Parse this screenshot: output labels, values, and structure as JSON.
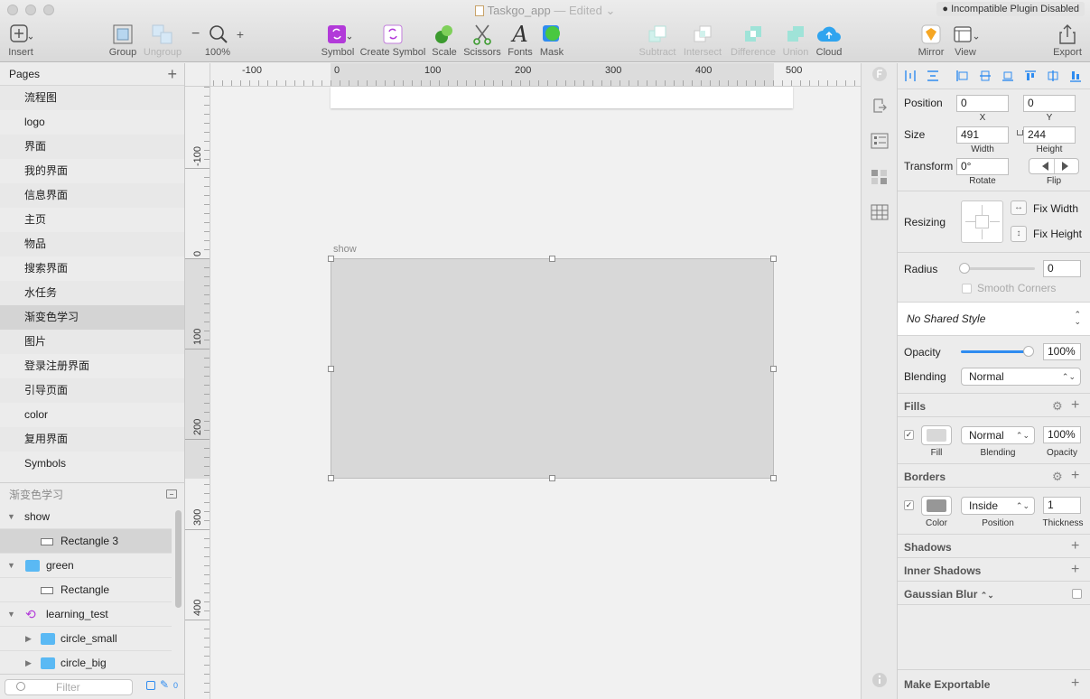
{
  "window": {
    "title": "Taskgo_app",
    "title_suffix": "— Edited",
    "plugin_badge": "Incompatible Plugin Disabled"
  },
  "toolbar": {
    "insert": "Insert",
    "group": "Group",
    "ungroup": "Ungroup",
    "zoom_minus": "−",
    "zoom_plus": "+",
    "zoom": "100%",
    "symbol": "Symbol",
    "create_symbol": "Create Symbol",
    "scale": "Scale",
    "scissors": "Scissors",
    "fonts": "Fonts",
    "mask": "Mask",
    "subtract": "Subtract",
    "intersect": "Intersect",
    "difference": "Difference",
    "union": "Union",
    "cloud": "Cloud",
    "mirror": "Mirror",
    "view": "View",
    "export": "Export"
  },
  "pages": {
    "header": "Pages",
    "items": [
      "流程图",
      "logo",
      "界面",
      "我的界面",
      "信息界面",
      "主页",
      "物品",
      "搜索界面",
      "水任务",
      "渐变色学习",
      "图片",
      "登录注册界面",
      "引导页面",
      "color",
      "复用界面",
      "Symbols"
    ],
    "selected": "渐变色学习"
  },
  "layers": {
    "page_title": "渐变色学习",
    "items": [
      {
        "name": "show",
        "kind": "group"
      },
      {
        "name": "Rectangle 3",
        "kind": "rect"
      },
      {
        "name": "green",
        "kind": "folder"
      },
      {
        "name": "Rectangle",
        "kind": "rect"
      },
      {
        "name": "learning_test",
        "kind": "symbol"
      },
      {
        "name": "circle_small",
        "kind": "folder"
      },
      {
        "name": "circle_big",
        "kind": "folder"
      }
    ],
    "filter_placeholder": "Filter",
    "count": "0"
  },
  "canvas": {
    "ruler_x": [
      "-100",
      "0",
      "100",
      "200",
      "300",
      "400",
      "500"
    ],
    "ruler_y": [
      "-100",
      "0",
      "100",
      "200",
      "300",
      "400"
    ],
    "artboard_name": "show"
  },
  "inspector": {
    "position_label": "Position",
    "x": "0",
    "x_label": "X",
    "y": "0",
    "y_label": "Y",
    "size_label": "Size",
    "width": "491",
    "width_label": "Width",
    "height": "244",
    "height_label": "Height",
    "transform_label": "Transform",
    "rotate": "0°",
    "rotate_label": "Rotate",
    "flip_label": "Flip",
    "resizing_label": "Resizing",
    "fix_width": "Fix Width",
    "fix_height": "Fix Height",
    "radius_label": "Radius",
    "radius": "0",
    "smooth_corners": "Smooth Corners",
    "shared_style": "No Shared Style",
    "opacity_label": "Opacity",
    "opacity": "100%",
    "blending_label": "Blending",
    "blending": "Normal",
    "fills_title": "Fills",
    "fill_label": "Fill",
    "fill_blending": "Normal",
    "fill_blending_label": "Blending",
    "fill_opacity": "100%",
    "fill_opacity_label": "Opacity",
    "fill_color": "#d8d8d8",
    "borders_title": "Borders",
    "border_color_label": "Color",
    "border_position": "Inside",
    "border_position_label": "Position",
    "border_thickness": "1",
    "border_thickness_label": "Thickness",
    "border_color": "#979797",
    "shadows_title": "Shadows",
    "inner_shadows_title": "Inner Shadows",
    "gaussian_blur_title": "Gaussian Blur",
    "make_exportable": "Make Exportable"
  },
  "colors": {
    "accent_blue": "#2f8cf0",
    "symbol_purple": "#b23ad9",
    "boolean_teal": "#58d5c4"
  }
}
